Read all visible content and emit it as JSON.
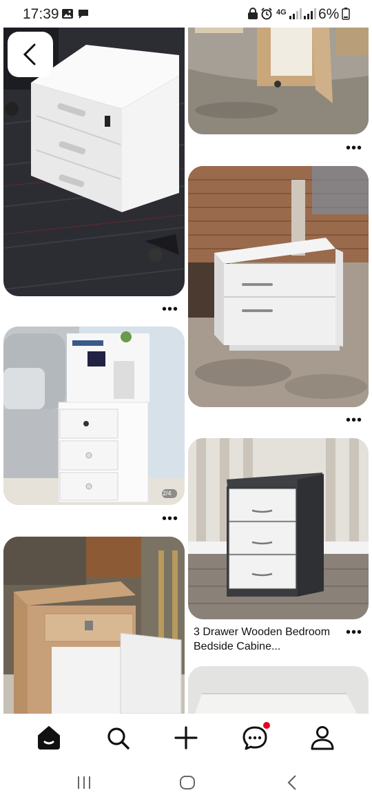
{
  "status_bar": {
    "time": "17:39",
    "network": "4G",
    "battery": "6%"
  },
  "feed": {
    "pins": [
      {
        "id": "pin-white-three-drawer-office",
        "has_more_menu": true
      },
      {
        "id": "pin-wood-cabinet-open-door",
        "has_more_menu": true
      },
      {
        "id": "pin-white-two-drawer-cabinet",
        "has_more_menu": true
      },
      {
        "id": "pin-bedside-shelf-three-drawer",
        "has_more_menu": true,
        "badge": "2/4"
      },
      {
        "id": "pin-grey-white-three-drawer",
        "has_more_menu": true,
        "caption": "3 Drawer Wooden Bedroom Bedside Cabine..."
      },
      {
        "id": "pin-wood-drawer-cabinet",
        "has_more_menu": false
      },
      {
        "id": "pin-white-board",
        "has_more_menu": false
      }
    ],
    "more_glyph": "•••"
  },
  "bottom_nav": {
    "items": [
      {
        "name": "home",
        "icon": "home-icon",
        "active": true
      },
      {
        "name": "search",
        "icon": "search-icon",
        "active": false
      },
      {
        "name": "create",
        "icon": "plus-icon",
        "active": false
      },
      {
        "name": "messages",
        "icon": "chat-icon",
        "active": false,
        "has_notification": true
      },
      {
        "name": "profile",
        "icon": "person-icon",
        "active": false
      }
    ]
  },
  "colors": {
    "accent_notification": "#e60023",
    "icon": "#111111",
    "background": "#ffffff"
  }
}
